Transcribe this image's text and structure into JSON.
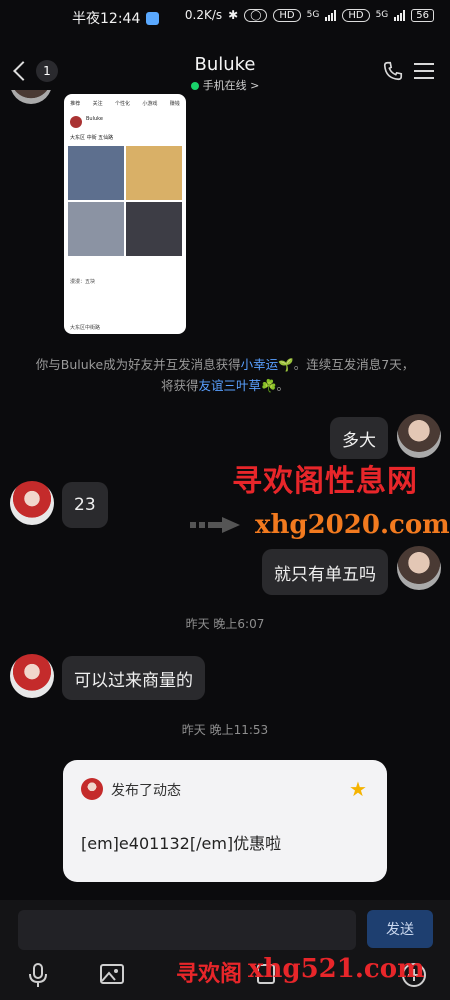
{
  "status_bar": {
    "time": "半夜12:44",
    "net_speed": "0.2K/s",
    "signal_1": "5G",
    "signal_2": "5G",
    "hd_1": "HD",
    "hd_2": "HD",
    "battery": "56"
  },
  "header": {
    "back_count": "1",
    "title": "Buluke",
    "status": "手机在线 >"
  },
  "shared_shot": {
    "tabs": [
      "推荐",
      "关注",
      "个性化",
      "小游戏",
      "赚钱"
    ],
    "name": "Buluke",
    "text": "大东区 中街 五仙路",
    "foot_1": "漫漫：五块",
    "foot_2": "大东区中街路"
  },
  "notice": {
    "line1_a": "你与Buluke成为好友并互发消息获得",
    "line1_link": "小幸运",
    "line1_b": "🌱。连续互发消息7天，",
    "line2_a": "将获得",
    "line2_link": "友谊三叶草",
    "line2_b": "☘️。"
  },
  "messages": {
    "m1": "多大",
    "m2": "23",
    "m3": "就只有单五吗",
    "m4": "可以过来商量的"
  },
  "timestamps": {
    "t1": "昨天 晚上6:07",
    "t2": "昨天 晚上11:53"
  },
  "dynamic_card": {
    "header": "发布了动态",
    "body": "[em]e401132[/em]优惠啦",
    "star": "2"
  },
  "watermark": {
    "title": "寻欢阁性息网",
    "site_1": "xhg2020.com",
    "bottom_cn": "寻欢阁",
    "bottom_site": "xhg521.com"
  },
  "input_bar": {
    "placeholder": "",
    "send_label": "发送"
  },
  "colors": {
    "background": "#0b0b0d",
    "bubble": "#2a2a2d",
    "link": "#5aa0ff",
    "online": "#19d26a",
    "watermark_red": "#e8262a",
    "watermark_orange": "#f27a1f"
  }
}
